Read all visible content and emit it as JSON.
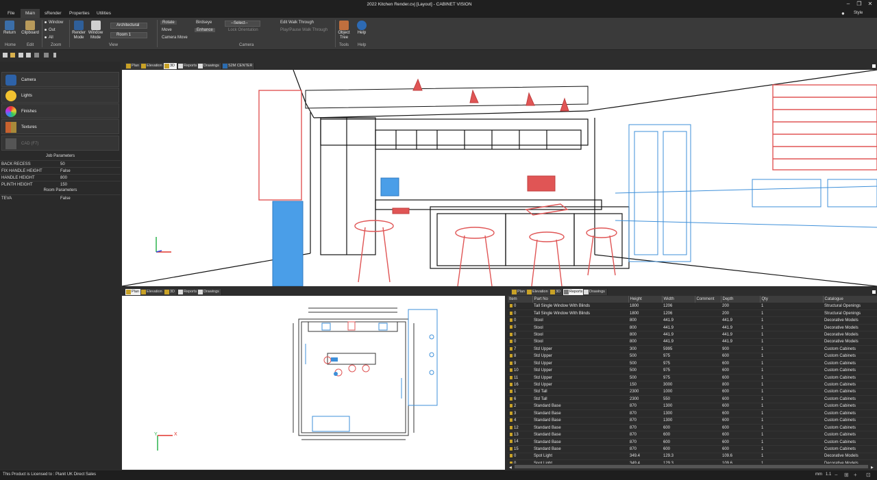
{
  "window": {
    "title": "2022 Kitchen Render.cvj [Layout] - CABINET VISION",
    "style_label": "Style"
  },
  "menu": {
    "tabs": [
      "File",
      "Main",
      "sRender",
      "Properties",
      "Utilities"
    ],
    "active": "Main"
  },
  "ribbon": {
    "return_label": "Return",
    "clipboard_label": "Clipboard",
    "zoom_window": "Window",
    "zoom_out": "Out",
    "zoom_all": "All",
    "render_mode": "Render Mode",
    "window_mode": "Window Mode",
    "style_value": "Architectural",
    "room_value": "Room 1",
    "rotate": "Rotate",
    "move": "Move",
    "camera_move": "Camera Move",
    "birdseye": "Birdseye",
    "enhance": "Enhance",
    "select_value": "--Select--",
    "lock_orientation": "Lock Orientation",
    "edit_walk": "Edit Walk Through",
    "play_walk": "Play/Pause Walk Through",
    "object_tree": "Object Tree",
    "help": "Help",
    "groups": {
      "home": "Home",
      "edit": "Edit",
      "zoom": "Zoom",
      "view": "View",
      "camera": "Camera",
      "tools": "Tools",
      "help": "Help"
    }
  },
  "left_panel": {
    "buttons": [
      "Camera",
      "Lights",
      "Finishes",
      "Textures",
      "CAD (F7)"
    ],
    "job_params_title": "Job Parameters",
    "room_params_title": "Room Parameters",
    "params": [
      {
        "key": "BACK RECESS",
        "value": "50"
      },
      {
        "key": "FIX HANDLE HEIGHT",
        "value": "False"
      },
      {
        "key": "HANDLE HEIGHT",
        "value": "800"
      },
      {
        "key": "PLINTH HEIGHT",
        "value": "150"
      }
    ],
    "room_params": [
      {
        "key": "TEVA",
        "value": "False"
      }
    ]
  },
  "top_tabs": [
    "Plan",
    "Elevation",
    "3D",
    "Reports",
    "Drawings",
    "S2M CENTER"
  ],
  "plan_tabs": [
    "Plan",
    "Elevation",
    "3D",
    "Reports",
    "Drawings"
  ],
  "report_tabs": [
    "Plan",
    "Elevation",
    "3D",
    "Reports",
    "Drawings"
  ],
  "axes": {
    "x": "X",
    "y": "Y"
  },
  "report": {
    "columns": [
      "Item",
      "Part No",
      "Height",
      "Width",
      "Comment",
      "Depth",
      "Qty",
      "Catalogue"
    ],
    "rows": [
      [
        "0",
        "Tall Single Window With Blinds",
        "1800",
        "1206",
        "",
        "200",
        "1",
        "Structural Openings"
      ],
      [
        "0",
        "Tall Single Window With Blinds",
        "1800",
        "1206",
        "",
        "200",
        "1",
        "Structural Openings"
      ],
      [
        "0",
        "Stool",
        "800",
        "441.9",
        "",
        "441.9",
        "1",
        "Decorative Models"
      ],
      [
        "0",
        "Stool",
        "800",
        "441.9",
        "",
        "441.9",
        "1",
        "Decorative Models"
      ],
      [
        "0",
        "Stool",
        "800",
        "441.9",
        "",
        "441.9",
        "1",
        "Decorative Models"
      ],
      [
        "0",
        "Stool",
        "800",
        "441.9",
        "",
        "441.9",
        "1",
        "Decorative Models"
      ],
      [
        "7",
        "Std Upper",
        "300",
        "5995",
        "",
        "900",
        "1",
        "Custom Cabinets"
      ],
      [
        "8",
        "Std Upper",
        "500",
        "975",
        "",
        "600",
        "1",
        "Custom Cabinets"
      ],
      [
        "9",
        "Std Upper",
        "500",
        "975",
        "",
        "600",
        "1",
        "Custom Cabinets"
      ],
      [
        "10",
        "Std Upper",
        "500",
        "975",
        "",
        "600",
        "1",
        "Custom Cabinets"
      ],
      [
        "11",
        "Std Upper",
        "500",
        "975",
        "",
        "600",
        "1",
        "Custom Cabinets"
      ],
      [
        "16",
        "Std Upper",
        "150",
        "3000",
        "",
        "800",
        "1",
        "Custom Cabinets"
      ],
      [
        "1",
        "Std Tall",
        "2300",
        "1000",
        "",
        "600",
        "1",
        "Custom Cabinets"
      ],
      [
        "6",
        "Std Tall",
        "2300",
        "550",
        "",
        "600",
        "1",
        "Custom Cabinets"
      ],
      [
        "2",
        "Standard Base",
        "870",
        "1300",
        "",
        "600",
        "1",
        "Custom Cabinets"
      ],
      [
        "3",
        "Standard Base",
        "870",
        "1300",
        "",
        "600",
        "1",
        "Custom Cabinets"
      ],
      [
        "4",
        "Standard Base",
        "870",
        "1300",
        "",
        "600",
        "1",
        "Custom Cabinets"
      ],
      [
        "12",
        "Standard Base",
        "870",
        "600",
        "",
        "600",
        "1",
        "Custom Cabinets"
      ],
      [
        "13",
        "Standard Base",
        "870",
        "600",
        "",
        "600",
        "1",
        "Custom Cabinets"
      ],
      [
        "14",
        "Standard Base",
        "870",
        "600",
        "",
        "600",
        "1",
        "Custom Cabinets"
      ],
      [
        "15",
        "Standard Base",
        "870",
        "600",
        "",
        "600",
        "1",
        "Custom Cabinets"
      ],
      [
        "0",
        "Spot Light",
        "349.4",
        "129.3",
        "",
        "109.6",
        "1",
        "Decorative Models"
      ],
      [
        "0",
        "Spot Light",
        "349.4",
        "129.3",
        "",
        "109.6",
        "1",
        "Decorative Models"
      ]
    ]
  },
  "status": {
    "license": "This Product is Licensed to : Planit UK Direct Sales",
    "units": "mm",
    "scale": "1.1"
  },
  "colors": {
    "accent": "#3b6ea8",
    "wire_red": "#e05555",
    "wire_blue": "#3d8fd9"
  }
}
